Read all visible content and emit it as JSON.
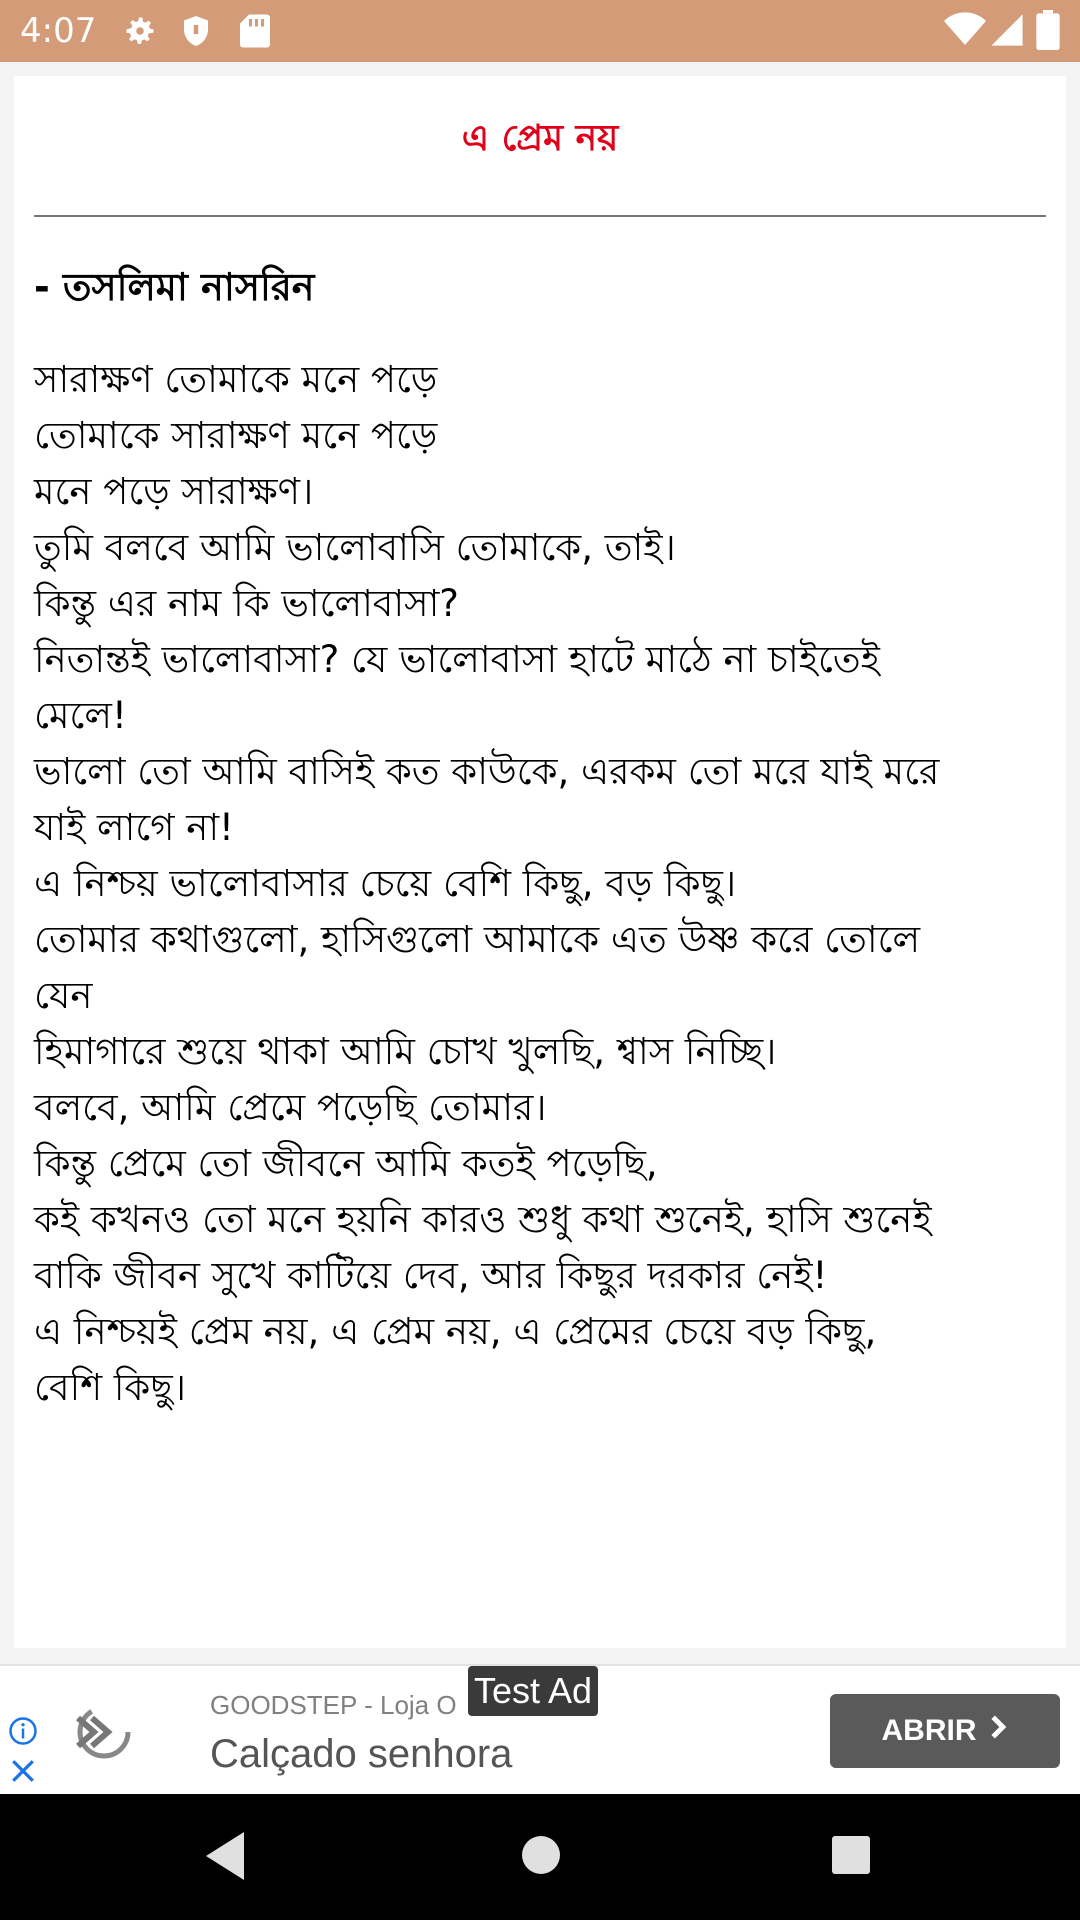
{
  "status_bar": {
    "time": "4:07",
    "icons": [
      "gear-icon",
      "shield-icon",
      "sd-card-icon",
      "wifi-icon",
      "signal-icon",
      "battery-icon"
    ]
  },
  "poem": {
    "title": "এ প্রেম নয়",
    "author": "- তসলিমা নাসরিন",
    "lines": [
      "সারাক্ষণ তোমাকে মনে পড়ে",
      "তোমাকে সারাক্ষণ মনে পড়ে",
      "মনে পড়ে সারাক্ষণ।",
      "তুমি বলবে আমি ভালোবাসি তোমাকে, তাই।",
      "কিন্তু এর নাম কি ভালোবাসা?",
      "নিতান্তই ভালোবাসা? যে ভালোবাসা হাটে মাঠে না চাইতেই",
      "মেলে!",
      "ভালো তো আমি বাসিই কত কাউকে, এরকম তো মরে যাই মরে",
      "যাই লাগে না!",
      "এ নিশ্চয় ভালোবাসার চেয়ে বেশি কিছু, বড় কিছু।",
      "তোমার কথাগুলো, হাসিগুলো আমাকে এত উষ্ণ করে তোলে",
      "যেন",
      "হিমাগারে শুয়ে থাকা আমি চোখ খুলছি, শ্বাস নিচ্ছি।",
      "বলবে, আমি প্রেমে পড়েছি তোমার।",
      "কিন্তু প্রেমে তো জীবনে আমি কতই পড়েছি,",
      "কই কখনও তো মনে হয়নি কারও শুধু কথা শুনেই, হাসি শুনেই",
      "বাকি জীবন সুখে কাটিয়ে দেব, আর কিছুর দরকার নেই!",
      "এ নিশ্চয়ই প্রেম নয়, এ প্রেম নয়, এ প্রেমের চেয়ে বড় কিছু,",
      "বেশি কিছু।"
    ]
  },
  "ad": {
    "test_label": "Test Ad",
    "advertiser": "GOODSTEP - Loja O",
    "headline": "Calçado senhora",
    "cta_label": "ABRIR",
    "info_icon": "info-icon",
    "close_icon": "close-icon"
  },
  "colors": {
    "status_bar": "#d49b78",
    "title": "#e0001a",
    "cta": "#5a5a5a",
    "ad_icon": "#1a73e8"
  }
}
